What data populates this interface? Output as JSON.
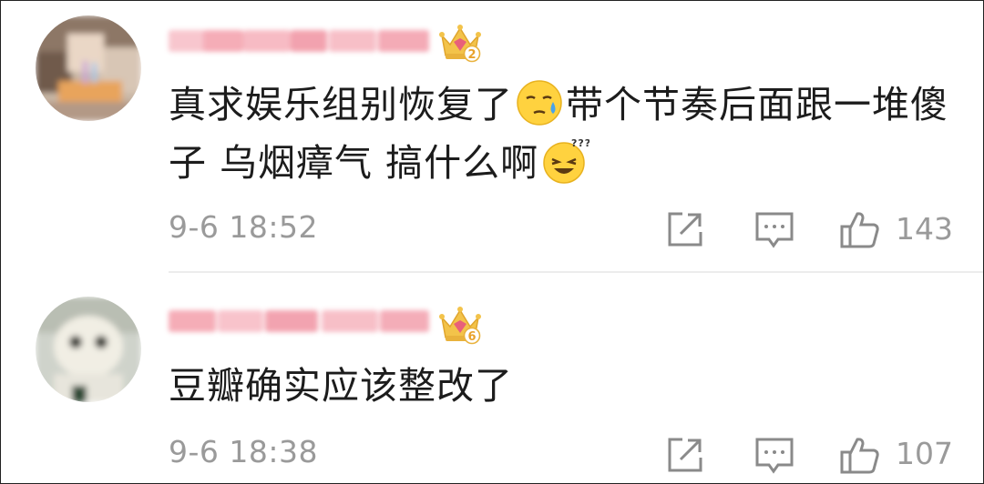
{
  "comments": [
    {
      "username": "",
      "level_badge": "2",
      "text_part1": "真求娱乐组别恢复了",
      "emoji1": "sweat-face-emoji",
      "text_part2": "带个节奏后面跟一堆傻子 乌烟瘴气 搞什么啊",
      "emoji2": "dizzy-grin-emoji",
      "time": "9-6 18:52",
      "likes": "143"
    },
    {
      "username": "",
      "level_badge": "6",
      "text_part1": "豆瓣确实应该整改了",
      "time": "9-6 18:38",
      "likes": "107"
    }
  ],
  "icons": {
    "share": "share-icon",
    "comment": "comment-icon",
    "like": "thumbs-up-icon",
    "badge": "crown-badge-icon"
  },
  "colors": {
    "username_blur": "#f7b3bd",
    "meta_gray": "#9a9a9a",
    "badge_gold": "#f3c34a",
    "badge_pink": "#e8607a"
  }
}
